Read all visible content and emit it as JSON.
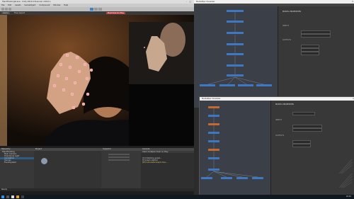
{
  "unity": {
    "title": "HandTrackingScene - Unity 2019.4 Personal <DX11>",
    "menu": [
      "File",
      "Edit",
      "Assets",
      "GameObject",
      "Component",
      "Window",
      "Help"
    ],
    "game_tab": "Game",
    "game_label": "Free Aspect",
    "maximize_label": "Maximize On Play",
    "panels": {
      "hierarchy": "Hierarchy",
      "project": "Project",
      "inspector": "Inspector",
      "console": "Console"
    },
    "hierarchy_items": [
      "HandTracking",
      "Main Camera",
      "Directional Light",
      "Annotation",
      "Canvas",
      "EventSystem"
    ],
    "console_lines": [
      "Clear  Collapse  Clear on Play",
      "[I] Initializing graph...",
      "[I] Graph started",
      "[W] CalculatorGraph::Run..."
    ],
    "status": "Ready"
  },
  "viz1": {
    "title": "MediaPipe Visualizer",
    "props_title": "MODEL PROPERTIES",
    "props_sub": "INPUTS",
    "props_sub2": "OUTPUTS"
  },
  "viz2": {
    "title": "MediaPipe Visualizer",
    "props_title": "MODEL PROPERTIES",
    "props_sub": "INPUTS",
    "props_sub2": "OUTPUTS"
  },
  "taskbar": {
    "clock": "18:42"
  }
}
